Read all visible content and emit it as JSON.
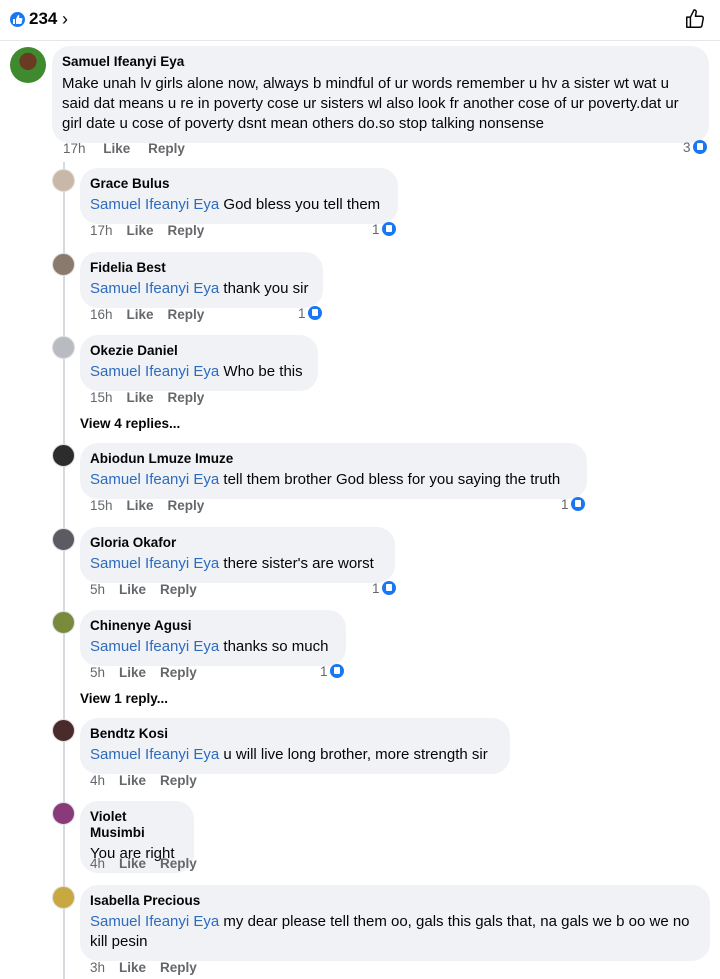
{
  "header": {
    "reaction_count": "234",
    "chevron": "›"
  },
  "main_comment": {
    "author": "Samuel Ifeanyi Eya",
    "text": "Make unah lv girls alone now, always b mindful of ur words remember u hv a sister wt wat u said dat means u re in poverty cose ur sisters wl also look fr another cose of ur poverty.dat ur girl date u cose of poverty dsnt mean others do.so stop talking nonsense",
    "time": "17h",
    "like": "Like",
    "reply": "Reply",
    "reactions": "3"
  },
  "replies": [
    {
      "author": "Grace Bulus",
      "mention": "Samuel Ifeanyi Eya",
      "text": " God bless you tell them",
      "time": "17h",
      "like": "Like",
      "reply": "Reply",
      "reactions": "1",
      "avatar_color": "#c9b8a8"
    },
    {
      "author": "Fidelia Best",
      "mention": "Samuel Ifeanyi Eya",
      "text": " thank you sir",
      "time": "16h",
      "like": "Like",
      "reply": "Reply",
      "reactions": "1",
      "avatar_color": "#8a7a6e"
    },
    {
      "author": "Okezie Daniel",
      "mention": "Samuel Ifeanyi Eya",
      "text": " Who be this",
      "time": "15h",
      "like": "Like",
      "reply": "Reply",
      "reactions": "",
      "avatar_color": "#b8bcc2"
    },
    {
      "author": "Abiodun Lmuze Imuze",
      "mention": "Samuel Ifeanyi Eya",
      "text": " tell them brother God bless for you saying the truth",
      "time": "15h",
      "like": "Like",
      "reply": "Reply",
      "reactions": "1",
      "avatar_color": "#2c2c2c"
    },
    {
      "author": "Gloria Okafor",
      "mention": "Samuel Ifeanyi Eya",
      "text": " there sister's are worst",
      "time": "5h",
      "like": "Like",
      "reply": "Reply",
      "reactions": "1",
      "avatar_color": "#5c5a62"
    },
    {
      "author": "Chinenye Agusi",
      "mention": "Samuel Ifeanyi Eya",
      "text": " thanks so much",
      "time": "5h",
      "like": "Like",
      "reply": "Reply",
      "reactions": "1",
      "avatar_color": "#7a8a3c"
    },
    {
      "author": "Bendtz Kosi",
      "mention": "Samuel Ifeanyi Eya",
      "text": " u will live long brother, more strength sir",
      "time": "4h",
      "like": "Like",
      "reply": "Reply",
      "reactions": "",
      "avatar_color": "#4a2a2a"
    },
    {
      "author": "Violet Musimbi",
      "mention": "",
      "text": "You are right",
      "time": "4h",
      "like": "Like",
      "reply": "Reply",
      "reactions": "",
      "avatar_color": "#8a3a7a"
    },
    {
      "author": "Isabella Precious",
      "mention": "Samuel Ifeanyi Eya",
      "text": " my dear please tell them oo, gals this gals that, na gals we b oo we no kill pesin",
      "time": "3h",
      "like": "Like",
      "reply": "Reply",
      "reactions": "",
      "avatar_color": "#c8a840"
    }
  ],
  "view_replies_1": "View 4 replies...",
  "view_replies_2": "View 1 reply...",
  "colors": {
    "accent": "#1877f2",
    "mention": "#2d6bbf",
    "bubble": "#f0f2f5"
  }
}
